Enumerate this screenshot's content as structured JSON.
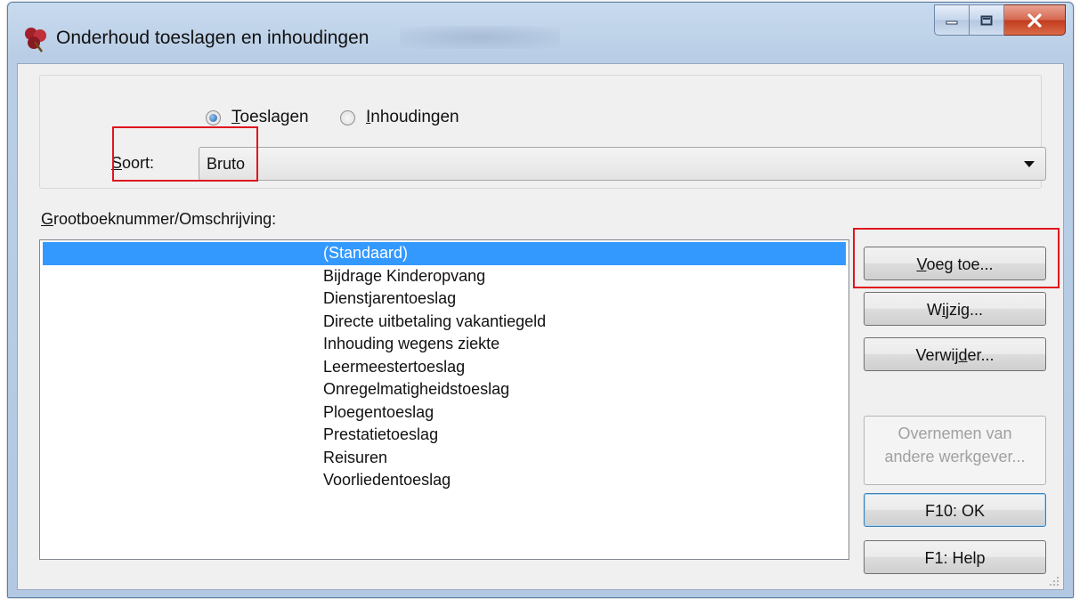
{
  "window": {
    "title": "Onderhoud toeslagen en inhoudingen",
    "icons": {
      "app": "cloverleaf-app-icon",
      "minimize": "minimize-icon",
      "maximize": "maximize-icon",
      "close": "close-icon"
    }
  },
  "type_selector": {
    "options": [
      {
        "key": "T",
        "rest": "oeslagen",
        "selected": true
      },
      {
        "key": "I",
        "rest": "nhoudingen",
        "selected": false
      }
    ]
  },
  "soort": {
    "label_key": "S",
    "label_rest": "oort:",
    "value": "Bruto"
  },
  "list": {
    "label_key": "G",
    "label_rest": "rootboeknummer/Omschrijving:",
    "selected_index": 0,
    "items": [
      "(Standaard)",
      "Bijdrage Kinderopvang",
      "Dienstjarentoeslag",
      "Directe uitbetaling vakantiegeld",
      "Inhouding wegens ziekte",
      "Leermeestertoeslag",
      "Onregelmatigheidstoeslag",
      "Ploegentoeslag",
      "Prestatietoeslag",
      "Reisuren",
      "Voorliedentoeslag"
    ]
  },
  "buttons": {
    "add": {
      "key": "V",
      "rest": "oeg toe..."
    },
    "edit": {
      "pre": "W",
      "key": "i",
      "rest": "jzig..."
    },
    "delete": {
      "pre": "Verwij",
      "key": "d",
      "rest": "er..."
    },
    "copy_line1": "Overnemen van",
    "copy_line2": "andere werkgever...",
    "ok": "F10: OK",
    "help": "F1: Help"
  },
  "colors": {
    "selection": "#3399ff",
    "highlight_box": "#e0141e",
    "title_bar": "#b9cee6"
  }
}
